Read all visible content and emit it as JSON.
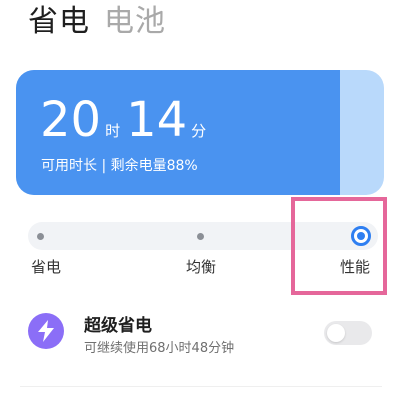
{
  "tabs": {
    "power_saving": "省电",
    "battery": "电池"
  },
  "battery_card": {
    "hours": "20",
    "hours_unit": "时",
    "minutes": "14",
    "minutes_unit": "分",
    "subtitle": "可用时长 | 剩余电量88%",
    "level_fraction": 0.88,
    "fill_color": "#4a93f0",
    "track_color": "#b9d9fb"
  },
  "mode_slider": {
    "options": [
      "省电",
      "均衡",
      "性能"
    ],
    "selected": "性能",
    "accent_color": "#2f7ff1"
  },
  "highlight_color": "#e5679a",
  "super_saver": {
    "icon": "lightning-icon",
    "title": "超级省电",
    "subtitle": "可继续使用68小时48分钟",
    "enabled": false,
    "icon_color": "#8b6ef7"
  }
}
